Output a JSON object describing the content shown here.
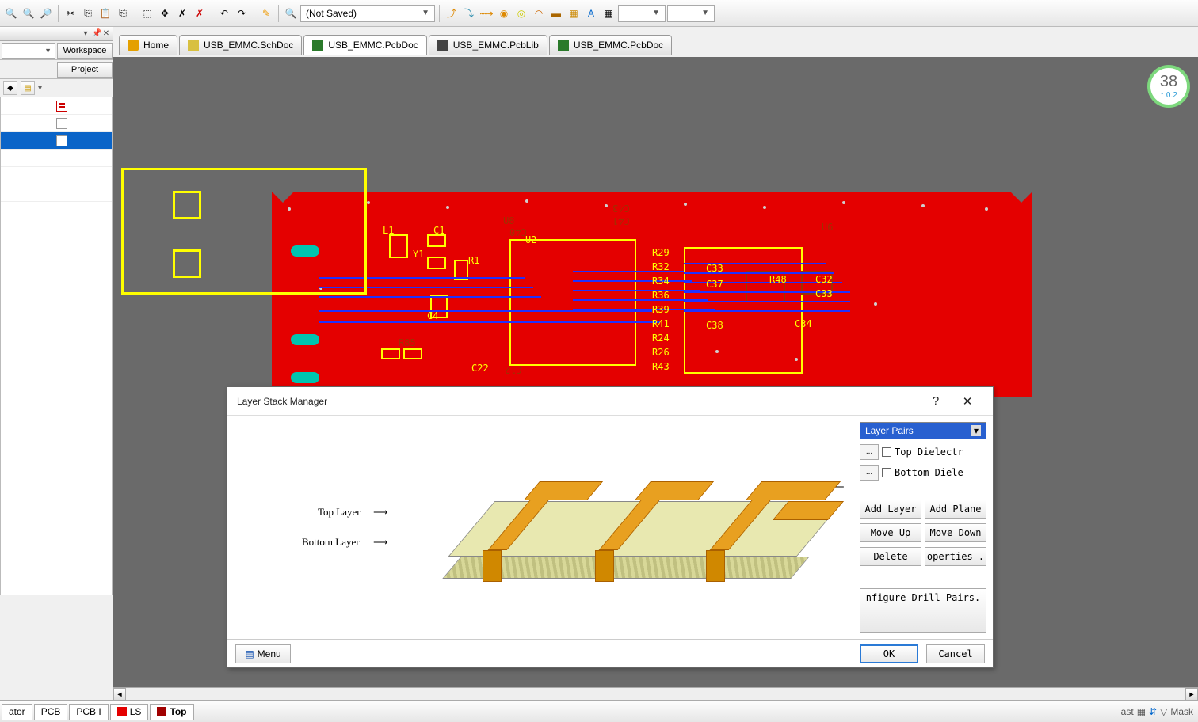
{
  "toolbar": {
    "combo_text": "(Not Saved)"
  },
  "left_panel": {
    "workspace_btn": "Workspace",
    "project_btn": "Project"
  },
  "doc_tabs": [
    {
      "label": "Home",
      "icon": "home"
    },
    {
      "label": "USB_EMMC.SchDoc",
      "icon": "sch"
    },
    {
      "label": "USB_EMMC.PcbDoc",
      "icon": "pcb"
    },
    {
      "label": "USB_EMMC.PcbLib",
      "icon": "lib"
    },
    {
      "label": "USB_EMMC.PcbDoc",
      "icon": "pcb2"
    }
  ],
  "badge": {
    "big": "38",
    "small": "↑ 0.2"
  },
  "pcb_silk": {
    "L1": "L1",
    "C1": "C1",
    "Y1": "Y1",
    "R1": "R1",
    "U2": "U2",
    "C4": "C4",
    "C22": "C22",
    "R29": "R29",
    "R32": "R32",
    "R34": "R34",
    "R36": "R36",
    "R39": "R39",
    "R41": "R41",
    "R24": "R24",
    "R26": "R26",
    "R43": "R43",
    "C33a": "C33",
    "C37": "C37",
    "R48": "R48",
    "C32": "C32",
    "C33b": "C33",
    "C38": "C38",
    "C34": "C34",
    "U8": "U8",
    "U6": "U6",
    "C40": "C40",
    "C41": "C41",
    "C43": "C43",
    "C12": "C12",
    "R85": "R85"
  },
  "bottom_tabs": {
    "ator": "ator",
    "pcb": "PCB",
    "pcbi": "PCB I",
    "ls": "LS",
    "top": "Top"
  },
  "status_right": {
    "last": "ast",
    "mask": "Mask"
  },
  "dialog": {
    "title": "Layer Stack Manager",
    "help": "?",
    "close": "✕",
    "graphic": {
      "top_label": "Top Layer",
      "bottom_label": "Bottom Layer",
      "arrow": "⟶"
    },
    "side": {
      "combo": "Layer Pairs",
      "ellipsis": "...",
      "chk_top": "Top Dielectr",
      "chk_bottom": "Bottom Diele",
      "add_layer": "Add Layer",
      "add_plane": "Add Plane",
      "move_up": "Move Up",
      "move_down": "Move Down",
      "delete": "Delete",
      "properties": "operties .",
      "drill": "nfigure Drill Pairs."
    },
    "footer": {
      "menu": "Menu",
      "ok": "OK",
      "cancel": "Cancel"
    }
  }
}
